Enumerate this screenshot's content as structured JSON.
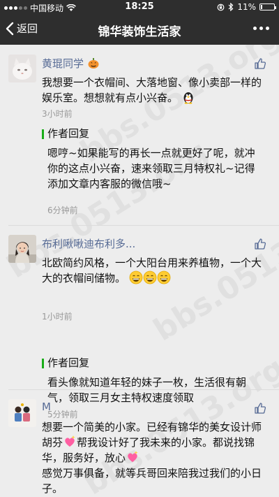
{
  "status_bar": {
    "carrier": "中国移动",
    "time": "18:25",
    "battery": "11%",
    "battery_fraction": 0.11
  },
  "nav": {
    "back_label": "返回",
    "title": "锦华装饰生活家"
  },
  "comments": [
    {
      "nickname": "黄琨同学",
      "text": "我想要一个衣帽间、大落地窗、像小卖部一样的娱乐室。想想就有点小兴奋。",
      "time": "3小时前"
    },
    {
      "nickname": "布利啾啾迪布利多...",
      "text": "北欧简约风格，一个大阳台用来养植物，一个大大的衣帽间储物。",
      "time": "1小时前"
    },
    {
      "nickname": "M",
      "text": "想要一个简美的小家。已经有锦华的美女设计师胡芬",
      "text_b": "帮我设计好了我未来的小家。都说找锦华，服务好，放心",
      "text_c": "感觉万事俱备，就等兵哥回来陪我过我们的小日子。"
    }
  ],
  "replies": [
    {
      "label": "作者回复",
      "text": "嗯哼~如果能写的再长一点就更好了呢，就冲你的这点小兴奋，速来领取三月特权礼~记得添加文章内客服的微信哦~",
      "time": "6分钟前"
    },
    {
      "label": "作者回复",
      "text": "看头像就知道年轻的妹子一枚，生活很有朝气，领取三月女主特权速度领取",
      "time": "5分钟前"
    }
  ],
  "watermark": "bbs.0513.org"
}
